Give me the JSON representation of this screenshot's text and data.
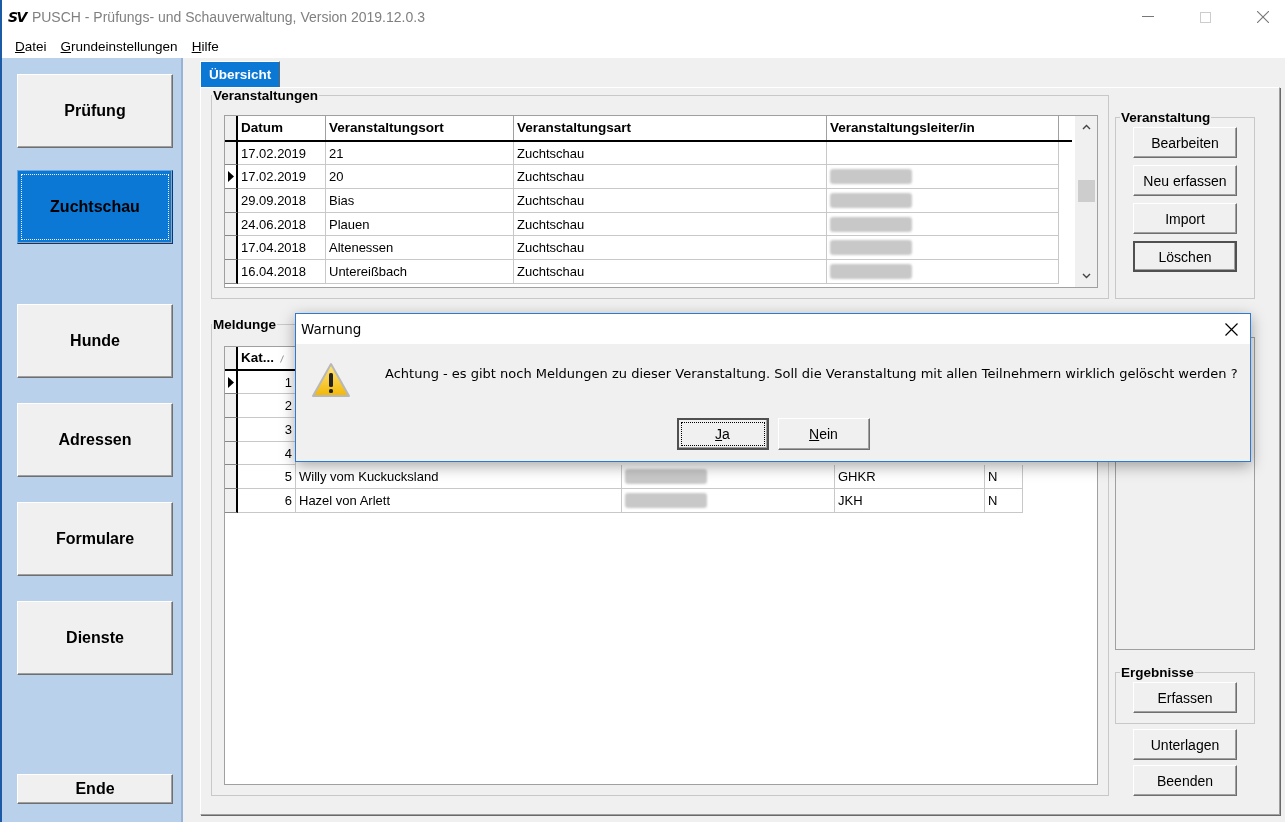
{
  "window": {
    "logo": "SV",
    "title": "PUSCH - Prüfungs- und Schauverwaltung, Version 2019.12.0.3",
    "active": false
  },
  "menu": [
    {
      "label": "Datei",
      "mnemonic": true
    },
    {
      "label": "Grundeinstellungen",
      "mnemonic": true
    },
    {
      "label": "Hilfe",
      "mnemonic": true
    }
  ],
  "sidebar": {
    "groups": [
      [
        {
          "label": "Prüfung",
          "selected": false
        },
        {
          "label": "Zuchtschau",
          "selected": true
        }
      ],
      [
        {
          "label": "Hunde",
          "selected": false
        },
        {
          "label": "Adressen",
          "selected": false
        },
        {
          "label": "Formulare",
          "selected": false
        },
        {
          "label": "Dienste",
          "selected": false
        }
      ],
      [
        {
          "label": "Ende",
          "selected": false
        }
      ]
    ]
  },
  "tabs": [
    {
      "label": "Übersicht",
      "selected": true
    }
  ],
  "events": {
    "title": "Veranstaltungen",
    "columns": [
      "Datum",
      "Veranstaltungsort",
      "Veranstaltungsart",
      "Veranstaltungsleiter/in"
    ],
    "rows": [
      {
        "current": false,
        "cells": [
          "17.02.2019",
          "21",
          "Zuchtschau"
        ],
        "leader_redacted": false
      },
      {
        "current": true,
        "cells": [
          "17.02.2019",
          "20",
          "Zuchtschau"
        ],
        "leader_redacted": true
      },
      {
        "current": false,
        "cells": [
          "29.09.2018",
          "Bias",
          "Zuchtschau"
        ],
        "leader_redacted": true
      },
      {
        "current": false,
        "cells": [
          "24.06.2018",
          "Plauen",
          "Zuchtschau"
        ],
        "leader_redacted": true
      },
      {
        "current": false,
        "cells": [
          "17.04.2018",
          "Altenessen",
          "Zuchtschau"
        ],
        "leader_redacted": true
      },
      {
        "current": false,
        "cells": [
          "16.04.2018",
          "Untereißbach",
          "Zuchtschau"
        ],
        "leader_redacted": true
      }
    ]
  },
  "event_actions": {
    "title": "Veranstaltung",
    "buttons": [
      {
        "label": "Bearbeiten",
        "focused": false
      },
      {
        "label": "Neu erfassen",
        "focused": false
      },
      {
        "label": "Import",
        "focused": false
      },
      {
        "label": "Löschen",
        "focused": true
      }
    ]
  },
  "entries": {
    "title": "Meldunge",
    "columns": [
      "Kat..."
    ],
    "rows": [
      {
        "current": true,
        "nr": "1"
      },
      {
        "current": false,
        "nr": "2"
      },
      {
        "current": false,
        "nr": "3"
      },
      {
        "current": false,
        "nr": "4"
      },
      {
        "current": false,
        "nr": "5",
        "name": "Willy vom Kuckucksland",
        "owner_redacted": true,
        "class": "GHKR",
        "flag": "N"
      },
      {
        "current": false,
        "nr": "6",
        "name": "Hazel von Arlett",
        "owner_redacted": true,
        "class": "JKH",
        "flag": "N"
      }
    ]
  },
  "results": {
    "title": "Ergebnisse",
    "buttons": [
      "Erfassen"
    ]
  },
  "bottom_buttons": [
    "Unterlagen",
    "Beenden"
  ],
  "dialog": {
    "title": "Warnung",
    "message": "Achtung - es gibt noch Meldungen zu dieser Veranstaltung. Soll die Veranstaltung mit allen Teilnehmern wirklich gelöscht werden ?",
    "buttons": [
      {
        "label": "Ja",
        "mnemonic": true,
        "default": true
      },
      {
        "label": "Nein",
        "mnemonic": true,
        "default": false
      }
    ]
  }
}
